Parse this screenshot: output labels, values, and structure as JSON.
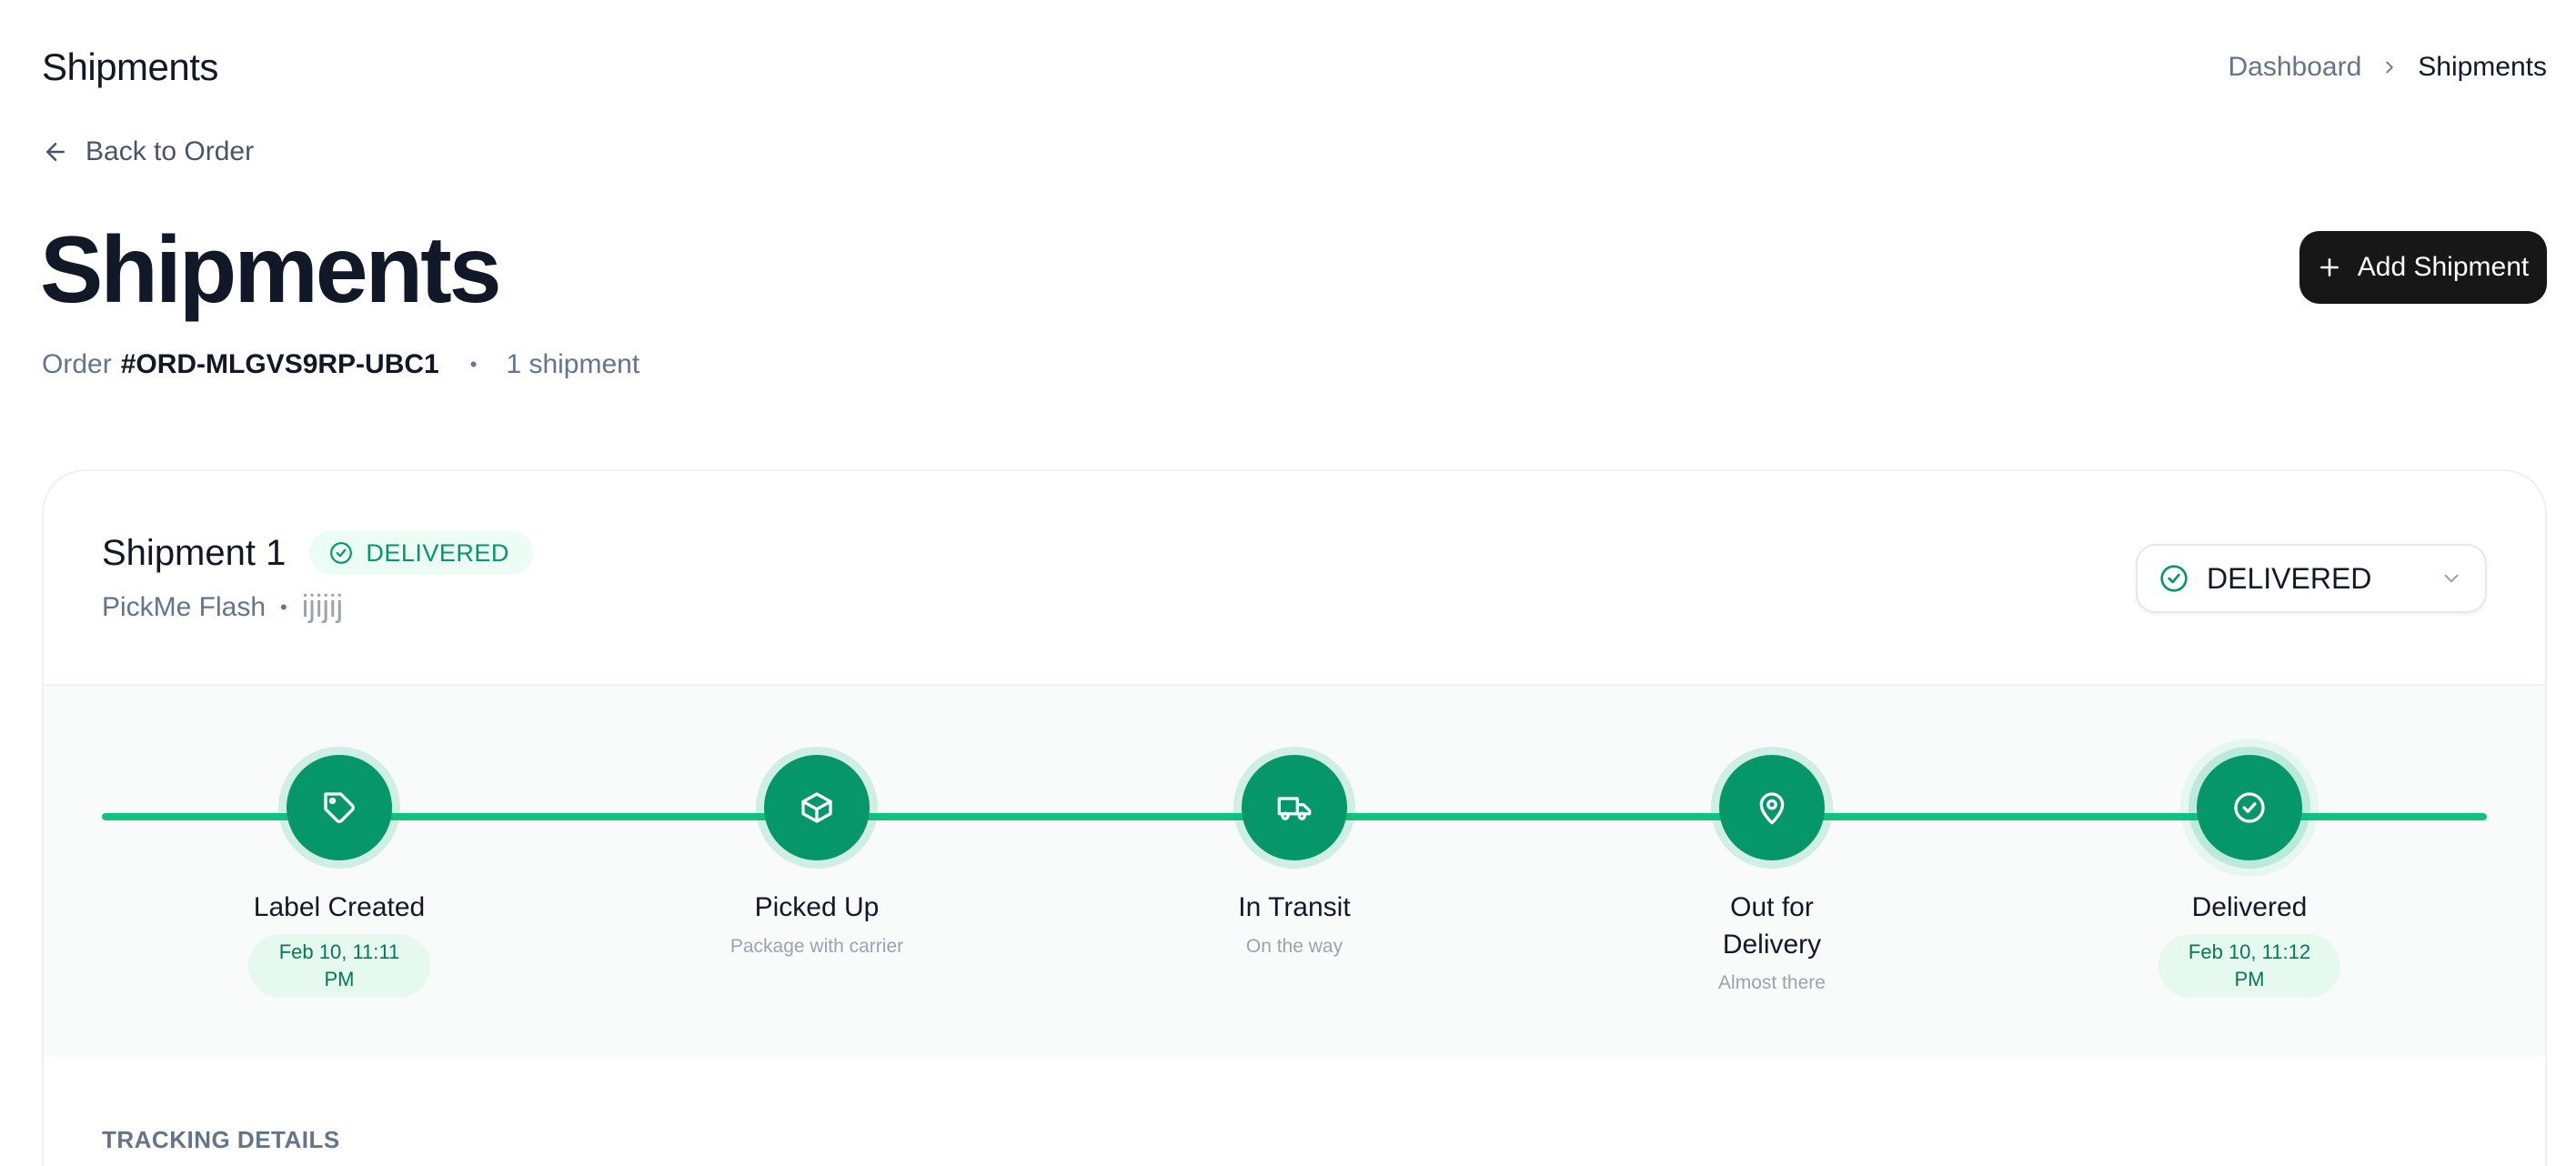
{
  "header": {
    "app_title": "Shipments",
    "breadcrumb": [
      "Dashboard",
      "Shipments"
    ]
  },
  "back_link": "Back to Order",
  "page": {
    "title": "Shipments",
    "order_prefix": "Order",
    "order_id": "#ORD-MLGVS9RP-UBC1",
    "shipment_count": "1 shipment",
    "add_button": "Add Shipment"
  },
  "shipment": {
    "title": "Shipment 1",
    "badge": "DELIVERED",
    "carrier": "PickMe Flash",
    "tracking_number": "ijijij",
    "status_select": "DELIVERED",
    "steps": [
      {
        "title": "Label Created",
        "date": "Feb 10, 11:11 PM",
        "icon": "tag-icon"
      },
      {
        "title": "Picked Up",
        "sub": "Package with carrier",
        "icon": "package-icon"
      },
      {
        "title": "In Transit",
        "sub": "On the way",
        "icon": "truck-icon"
      },
      {
        "title": "Out for Delivery",
        "sub": "Almost there",
        "icon": "map-pin-icon"
      },
      {
        "title": "Delivered",
        "date": "Feb 10, 11:12 PM",
        "icon": "check-circle-icon"
      }
    ],
    "tracking_section_title": "TRACKING DETAILS"
  },
  "colors": {
    "accent": "#059669",
    "progress": "#10c27f",
    "button_bg": "#171717"
  }
}
